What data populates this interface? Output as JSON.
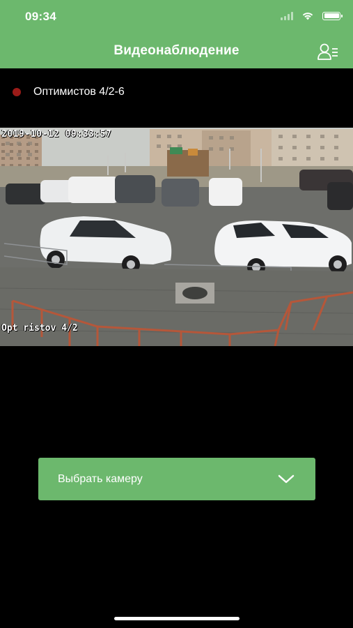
{
  "status_bar": {
    "time": "09:34",
    "icons": [
      "signal-icon",
      "wifi-icon",
      "battery-icon"
    ]
  },
  "header": {
    "title": "Видеонаблюдение",
    "right_icon": "user-list-icon",
    "color": "#6cb86d"
  },
  "camera": {
    "status_color": "#9b1b18",
    "name": "Оптимистов 4/2-6"
  },
  "video": {
    "timestamp": "2019-10-12 09:33:57",
    "overlay_name": "Opt ristov 4/2"
  },
  "select_camera": {
    "label": "Выбрать камеру",
    "icon": "chevron-down-icon"
  }
}
